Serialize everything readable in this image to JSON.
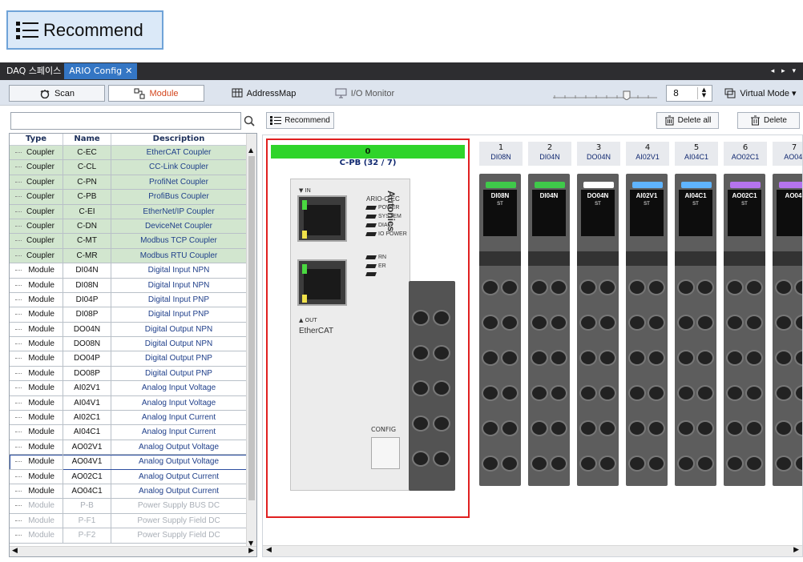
{
  "callout": {
    "label": "Recommend"
  },
  "tabs": {
    "daq": "DAQ 스페이스",
    "ario": "ARIO Config",
    "close": "✕",
    "scroll_arrows": "◂ ▸ ▾"
  },
  "toolbar": {
    "scan": "Scan",
    "module": "Module",
    "addressmap": "AddressMap",
    "io_monitor": "I/O Monitor",
    "zoom_value": "8",
    "virtual_mode": "Virtual Mode ▾"
  },
  "search": {
    "placeholder": "",
    "value": ""
  },
  "grid": {
    "headers": [
      "Type",
      "Name",
      "Description"
    ],
    "rows": [
      {
        "type": "Coupler",
        "name": "C-EC",
        "desc": "EtherCAT Coupler",
        "kind": "coupler"
      },
      {
        "type": "Coupler",
        "name": "C-CL",
        "desc": "CC-Link Coupler",
        "kind": "coupler"
      },
      {
        "type": "Coupler",
        "name": "C-PN",
        "desc": "ProfiNet Coupler",
        "kind": "coupler"
      },
      {
        "type": "Coupler",
        "name": "C-PB",
        "desc": "ProfiBus Coupler",
        "kind": "coupler"
      },
      {
        "type": "Coupler",
        "name": "C-EI",
        "desc": "EtherNet/IP Coupler",
        "kind": "coupler"
      },
      {
        "type": "Coupler",
        "name": "C-DN",
        "desc": "DeviceNet Coupler",
        "kind": "coupler"
      },
      {
        "type": "Coupler",
        "name": "C-MT",
        "desc": "Modbus TCP Coupler",
        "kind": "coupler"
      },
      {
        "type": "Coupler",
        "name": "C-MR",
        "desc": "Modbus RTU Coupler",
        "kind": "coupler"
      },
      {
        "type": "Module",
        "name": "DI04N",
        "desc": "Digital Input NPN",
        "kind": "module"
      },
      {
        "type": "Module",
        "name": "DI08N",
        "desc": "Digital Input NPN",
        "kind": "module"
      },
      {
        "type": "Module",
        "name": "DI04P",
        "desc": "Digital Input PNP",
        "kind": "module"
      },
      {
        "type": "Module",
        "name": "DI08P",
        "desc": "Digital Input PNP",
        "kind": "module"
      },
      {
        "type": "Module",
        "name": "DO04N",
        "desc": "Digital Output NPN",
        "kind": "module"
      },
      {
        "type": "Module",
        "name": "DO08N",
        "desc": "Digital Output NPN",
        "kind": "module"
      },
      {
        "type": "Module",
        "name": "DO04P",
        "desc": "Digital Output PNP",
        "kind": "module"
      },
      {
        "type": "Module",
        "name": "DO08P",
        "desc": "Digital Output PNP",
        "kind": "module"
      },
      {
        "type": "Module",
        "name": "AI02V1",
        "desc": "Analog Input Voltage",
        "kind": "module"
      },
      {
        "type": "Module",
        "name": "AI04V1",
        "desc": "Analog Input Voltage",
        "kind": "module"
      },
      {
        "type": "Module",
        "name": "AI02C1",
        "desc": "Analog Input Current",
        "kind": "module"
      },
      {
        "type": "Module",
        "name": "AI04C1",
        "desc": "Analog Input Current",
        "kind": "module"
      },
      {
        "type": "Module",
        "name": "AO02V1",
        "desc": "Analog Output Voltage",
        "kind": "module"
      },
      {
        "type": "Module",
        "name": "AO04V1",
        "desc": "Analog Output Voltage",
        "kind": "module selected"
      },
      {
        "type": "Module",
        "name": "AO02C1",
        "desc": "Analog Output Current",
        "kind": "module"
      },
      {
        "type": "Module",
        "name": "AO04C1",
        "desc": "Analog Output Current",
        "kind": "module"
      },
      {
        "type": "Module",
        "name": "P-B",
        "desc": "Power Supply BUS DC",
        "kind": "disabled"
      },
      {
        "type": "Module",
        "name": "P-F1",
        "desc": "Power Supply Field DC",
        "kind": "disabled"
      },
      {
        "type": "Module",
        "name": "P-F2",
        "desc": "Power Supply Field DC",
        "kind": "disabled"
      }
    ]
  },
  "right_toolbar": {
    "recommend": "Recommend",
    "delete_all": "Delete all",
    "delete": "Delete"
  },
  "canvas": {
    "coupler": {
      "slot": "0",
      "name": "C-PB (32 / 7)",
      "model": "ARIO-C-EC",
      "brand": "Autonics",
      "in_label": "▼ IN",
      "out_label": "▲ OUT",
      "ethercat": "EtherCAT",
      "config": "CONFIG",
      "leds": [
        "POWER",
        "SYSTEM",
        "DIAG",
        "IO POWER"
      ],
      "leds2": [
        "RN",
        "ER"
      ]
    },
    "modules": [
      {
        "slot": "1",
        "name": "DI08N",
        "label": "DI08N",
        "color": "#3fc94a",
        "st": "ST"
      },
      {
        "slot": "2",
        "name": "DI04N",
        "label": "DI04N",
        "color": "#3fc94a",
        "st": ""
      },
      {
        "slot": "3",
        "name": "DO04N",
        "label": "DO04N",
        "color": "#ffffff",
        "st": "ST"
      },
      {
        "slot": "4",
        "name": "AI02V1",
        "label": "AI02V1",
        "color": "#5fb4ff",
        "st": "ST"
      },
      {
        "slot": "5",
        "name": "AI04C1",
        "label": "AI04C1",
        "color": "#5fb4ff",
        "st": "ST"
      },
      {
        "slot": "6",
        "name": "AO02C1",
        "label": "AO02C1",
        "color": "#b574ee",
        "st": "ST"
      },
      {
        "slot": "7",
        "name": "AO04\\",
        "label": "AO04",
        "color": "#b574ee",
        "st": ""
      }
    ]
  }
}
